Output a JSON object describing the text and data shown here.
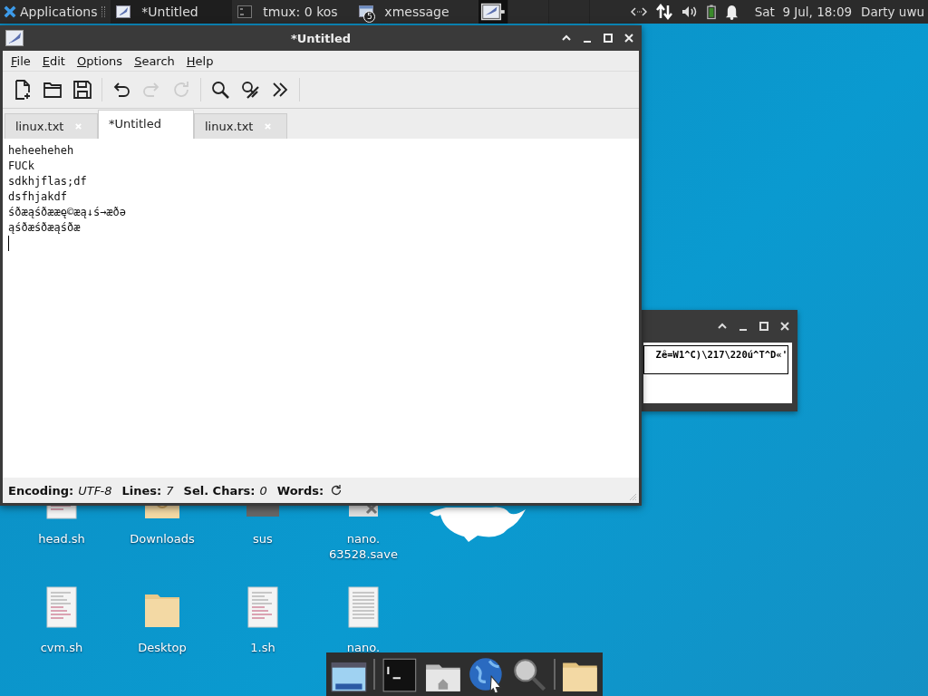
{
  "top_panel": {
    "apps_label": "Applications",
    "tasks": [
      {
        "title": "*Untitled",
        "kind": "editor",
        "selected": true
      },
      {
        "title": "tmux: 0 kos",
        "kind": "terminal",
        "selected": false
      },
      {
        "title": "xmessage",
        "kind": "message",
        "badge": "5",
        "selected": false
      }
    ],
    "clock": "Sat  9 Jul, 18:09",
    "user": "Darty uwu"
  },
  "desktop_icons": [
    {
      "label": "head.sh",
      "kind": "script"
    },
    {
      "label": "Downloads",
      "kind": "downloads"
    },
    {
      "label": "sus",
      "kind": "drive"
    },
    {
      "label": "nano. 63528.save",
      "kind": "broken"
    },
    {
      "label": "cvm.sh",
      "kind": "script"
    },
    {
      "label": "Desktop",
      "kind": "folder"
    },
    {
      "label": "1.sh",
      "kind": "script"
    },
    {
      "label": "nano.",
      "kind": "text"
    }
  ],
  "editor": {
    "title": "*Untitled",
    "menu": [
      "File",
      "Edit",
      "Options",
      "Search",
      "Help"
    ],
    "toolbar": [
      {
        "kind": "new",
        "disabled": false
      },
      {
        "kind": "open",
        "disabled": false
      },
      {
        "kind": "save",
        "disabled": false
      },
      {
        "kind": "sep"
      },
      {
        "kind": "undo",
        "disabled": false
      },
      {
        "kind": "redo",
        "disabled": true
      },
      {
        "kind": "reload",
        "disabled": true
      },
      {
        "kind": "sep"
      },
      {
        "kind": "find",
        "disabled": false
      },
      {
        "kind": "replace",
        "disabled": false
      },
      {
        "kind": "more",
        "disabled": false
      }
    ],
    "tabs": [
      {
        "label": "linux.txt",
        "selected": false
      },
      {
        "label": "*Untitled",
        "selected": true
      },
      {
        "label": "linux.txt",
        "selected": false
      }
    ],
    "lines": [
      "heheeheheh",
      "FUCk",
      "sdkhjflas;df",
      "dsfhjakdf",
      "śðæąśðææę©æą↓ś→æðə",
      "ąśðæśðæąśðæ"
    ],
    "status": [
      {
        "label": "Encoding:",
        "value": "UTF-8"
      },
      {
        "label": "Lines:",
        "value": "7"
      },
      {
        "label": "Sel. Chars:",
        "value": "0"
      },
      {
        "label": "Words:"
      }
    ]
  },
  "xmessage": {
    "text": "Zê=W1^C)\\217\\220ú^T^D«'"
  },
  "dock": [
    {
      "kind": "desktop"
    },
    {
      "kind": "sep"
    },
    {
      "kind": "terminal"
    },
    {
      "kind": "home"
    },
    {
      "kind": "browser"
    },
    {
      "kind": "search"
    },
    {
      "kind": "sep"
    },
    {
      "kind": "folder"
    }
  ]
}
